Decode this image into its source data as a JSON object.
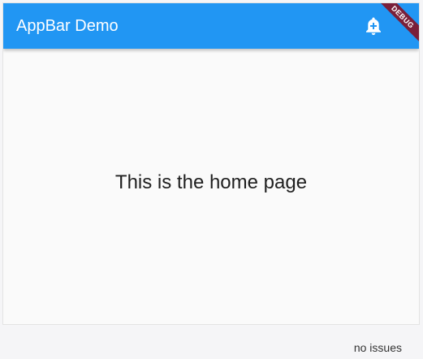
{
  "appbar": {
    "title": "AppBar Demo",
    "background": "#2196f3",
    "action_icon": "add-alert-icon"
  },
  "debug_banner": {
    "label": "DEBUG",
    "color": "#7a1f3a"
  },
  "main": {
    "message": "This is the home page"
  },
  "statusbar": {
    "text": "no issues"
  }
}
